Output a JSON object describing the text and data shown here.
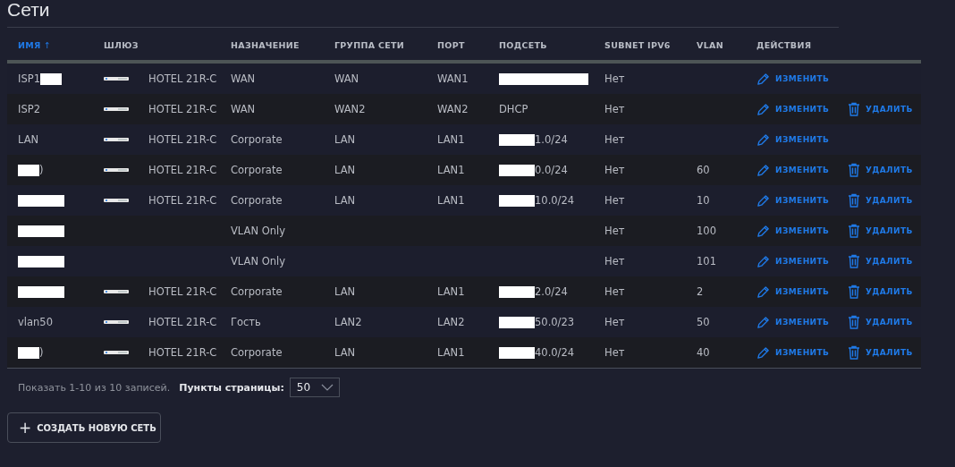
{
  "page_title": "Сети",
  "table": {
    "columns": [
      {
        "label": "ИМЯ",
        "sorted": true,
        "sort_arrow": "↑"
      },
      {
        "label": "ШЛЮЗ",
        "sorted": false
      },
      {
        "label": "НАЗНАЧЕНИЕ",
        "sorted": false
      },
      {
        "label": "ГРУППА СЕТИ",
        "sorted": false
      },
      {
        "label": "ПОРТ",
        "sorted": false
      },
      {
        "label": "ПОДСЕТЬ",
        "sorted": false
      },
      {
        "label": "SUBNET IPV6",
        "sorted": false
      },
      {
        "label": "VLAN",
        "sorted": false
      },
      {
        "label": "ДЕЙСТВИЯ",
        "sorted": false
      }
    ],
    "rows": [
      {
        "name": {
          "before": "ISP1",
          "redacted": true
        },
        "gateway": "HOTEL 21R-C",
        "purpose": "WAN",
        "group": "WAN",
        "port": "WAN1",
        "subnet": {
          "redacted": true
        },
        "ipv6": "Нет",
        "edit": "ИЗМЕНИТЬ"
      },
      {
        "name": {
          "before": "ISP2",
          "redacted": false
        },
        "gateway": "HOTEL 21R-C",
        "purpose": "WAN",
        "group": "WAN2",
        "port": "WAN2",
        "subnet": {
          "after": "DHCP",
          "redacted": false
        },
        "ipv6": "Нет",
        "edit": "ИЗМЕНИТЬ",
        "delete": "УДАЛИТЬ"
      },
      {
        "name": {
          "before": "LAN",
          "redacted": false
        },
        "gateway": "HOTEL 21R-C",
        "purpose": "Corporate",
        "group": "LAN",
        "port": "LAN1",
        "subnet": {
          "redacted": true,
          "after": "1.0/24"
        },
        "ipv6": "Нет",
        "edit": "ИЗМЕНИТЬ"
      },
      {
        "name": {
          "redacted": true,
          "after": ")"
        },
        "gateway": "HOTEL 21R-C",
        "purpose": "Corporate",
        "group": "LAN",
        "port": "LAN1",
        "subnet": {
          "redacted": true,
          "after": "0.0/24"
        },
        "ipv6": "Нет",
        "vlan": "60",
        "edit": "ИЗМЕНИТЬ",
        "delete": "УДАЛИТЬ"
      },
      {
        "name": {
          "redacted": true
        },
        "gateway": "HOTEL 21R-C",
        "purpose": "Corporate",
        "group": "LAN",
        "port": "LAN1",
        "subnet": {
          "redacted": true,
          "after": "10.0/24"
        },
        "ipv6": "Нет",
        "vlan": "10",
        "edit": "ИЗМЕНИТЬ",
        "delete": "УДАЛИТЬ"
      },
      {
        "name": {
          "redacted": true
        },
        "purpose": "VLAN Only",
        "ipv6": "Нет",
        "vlan": "100",
        "edit": "ИЗМЕНИТЬ",
        "delete": "УДАЛИТЬ"
      },
      {
        "name": {
          "redacted": true
        },
        "purpose": "VLAN Only",
        "ipv6": "Нет",
        "vlan": "101",
        "edit": "ИЗМЕНИТЬ",
        "delete": "УДАЛИТЬ"
      },
      {
        "name": {
          "redacted": true
        },
        "gateway": "HOTEL 21R-C",
        "purpose": "Corporate",
        "group": "LAN",
        "port": "LAN1",
        "subnet": {
          "redacted": true,
          "after": "2.0/24"
        },
        "ipv6": "Нет",
        "vlan": "2",
        "edit": "ИЗМЕНИТЬ",
        "delete": "УДАЛИТЬ"
      },
      {
        "name": {
          "before": "vlan50",
          "redacted": false
        },
        "gateway": "HOTEL 21R-C",
        "purpose": "Гость",
        "group": "LAN2",
        "port": "LAN2",
        "subnet": {
          "redacted": true,
          "after": "50.0/23"
        },
        "ipv6": "Нет",
        "vlan": "50",
        "edit": "ИЗМЕНИТЬ",
        "delete": "УДАЛИТЬ"
      },
      {
        "name": {
          "redacted": true,
          "after": ")"
        },
        "gateway": "HOTEL 21R-C",
        "purpose": "Corporate",
        "group": "LAN",
        "port": "LAN1",
        "subnet": {
          "redacted": true,
          "after": "40.0/24"
        },
        "ipv6": "Нет",
        "vlan": "40",
        "edit": "ИЗМЕНИТЬ",
        "delete": "УДАЛИТЬ"
      }
    ]
  },
  "footer": {
    "summary": "Показать 1-10 из 10 записей.",
    "page_size_label": "Пункты страницы:",
    "page_size": "50"
  },
  "create_button": {
    "icon": "+",
    "label": "СОЗДАТЬ НОВУЮ СЕТЬ"
  }
}
